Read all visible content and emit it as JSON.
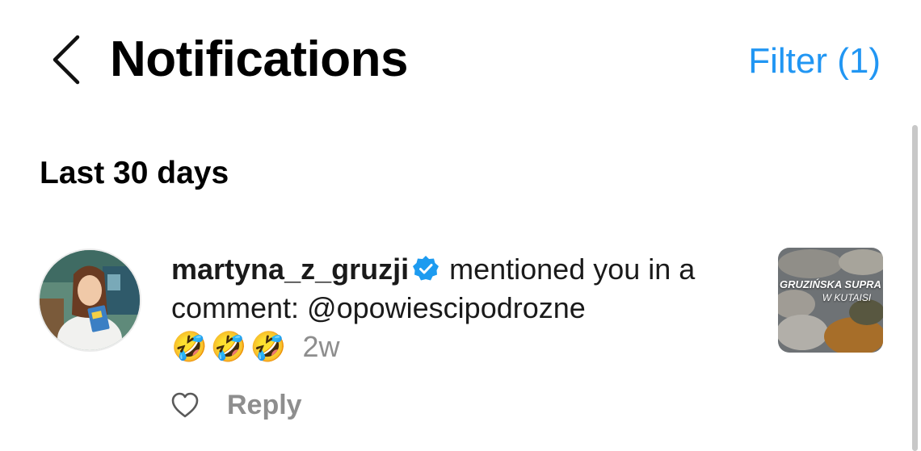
{
  "header": {
    "title": "Notifications",
    "filter_label": "Filter (1)",
    "back_icon": "chevron-left-icon"
  },
  "section": {
    "title": "Last 30 days"
  },
  "notification": {
    "username": "martyna_z_gruzji",
    "verified_icon": "verified-badge-icon",
    "action_text": " mentioned you in a comment: @opowiescipodrozne",
    "emojis": "🤣🤣🤣",
    "time": "2w",
    "thumbnail_caption": "GRUZIŃSKA SUPRA",
    "thumbnail_caption_sub": "W KUTAISI",
    "reply_label": "Reply",
    "like_icon": "heart-outline-icon"
  },
  "colors": {
    "accent": "#2196f3",
    "verified": "#1d9bf0",
    "muted": "#8e8e8e"
  }
}
